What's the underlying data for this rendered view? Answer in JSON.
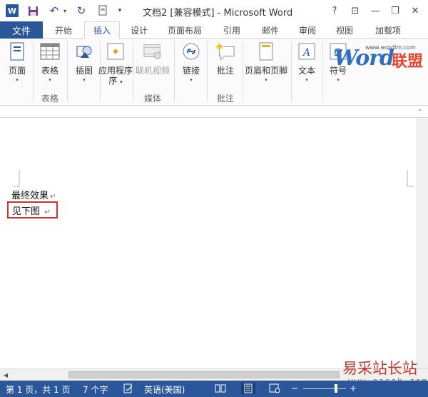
{
  "title_bar": {
    "title": "文档2 [兼容模式] - Microsoft Word",
    "app_icon_text": "W",
    "help": "?",
    "ribbon_display": "⊡",
    "minimize": "—",
    "restore": "❐",
    "close": "✕"
  },
  "tabs": {
    "file": "文件",
    "items": [
      "开始",
      "插入",
      "设计",
      "页面布局",
      "引用",
      "邮件",
      "审阅",
      "视图",
      "加载项"
    ],
    "active": "插入"
  },
  "ribbon": {
    "buttons": {
      "page": "页面",
      "table": "表格",
      "illustration": "插图",
      "apps": "应用程序",
      "apps2": "序",
      "online_video": "联机视频",
      "link": "链接",
      "comment": "批注",
      "header_footer": "页眉和页脚",
      "text": "文本",
      "symbol": "符号"
    },
    "groups": {
      "tables": "表格",
      "media": "媒体",
      "comments": "批注"
    }
  },
  "watermarks": {
    "word": "Word",
    "lianmeng": "联盟",
    "url": "www.wordlm.com",
    "bottom": "易采站长站",
    "bottom_url": "www.easck.com"
  },
  "document": {
    "line1": "最终效果",
    "line2": "见下图",
    "para_mark": "↵"
  },
  "status_bar": {
    "page": "第 1 页，共 1 页",
    "words": "7 个字",
    "language": "英语(美国)"
  },
  "colors": {
    "accent": "#2b579a",
    "highlight_box": "#d0312d"
  }
}
